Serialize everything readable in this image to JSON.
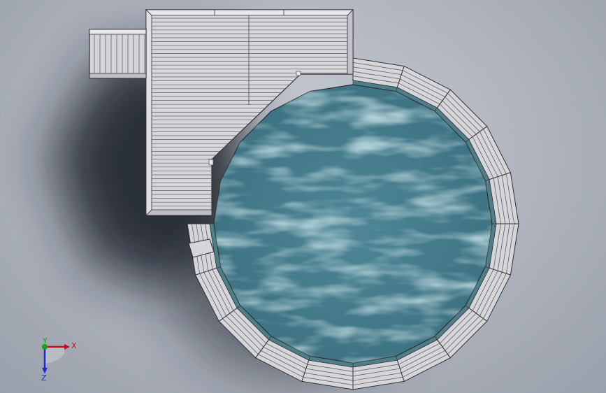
{
  "viewport": {
    "background": "#b4b9c2"
  },
  "model": {
    "parts": [
      "deck-platform",
      "stair-landing",
      "pool-water",
      "pool-rim-deck"
    ],
    "colors": {
      "deck": "#d6d6da",
      "deck_board_line": "#5e5e66",
      "outline": "#2f2f36",
      "water_dark": "#3f7687",
      "water_light": "#8fbcc6",
      "pool_wall": "#4e7f88",
      "shadow": "#1f242b"
    },
    "rim_segments": 20
  },
  "triad": {
    "x_label": "X",
    "y_label": "Y",
    "z_label": "Z",
    "x_color": "#c0101a",
    "y_color": "#1aa01a",
    "z_color": "#1a2ad0"
  }
}
